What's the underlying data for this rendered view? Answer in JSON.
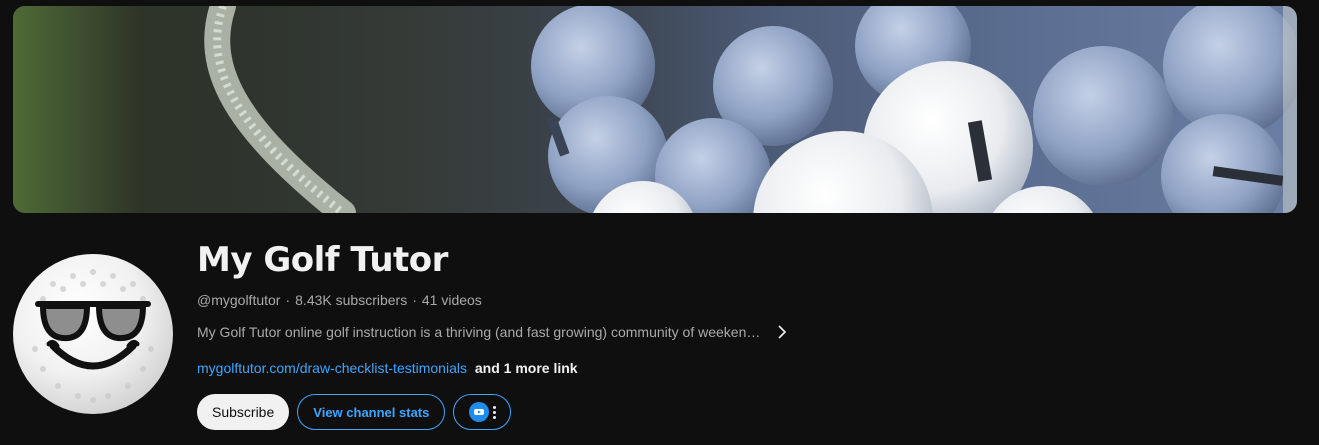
{
  "channel": {
    "name": "My Golf Tutor",
    "handle": "@mygolftutor",
    "subscribers": "8.43K subscribers",
    "videos": "41 videos",
    "separator": "·",
    "description": "My Golf Tutor online golf instruction is a thriving (and fast growing) community of weeken…",
    "link_text": "mygolftutor.com/draw-checklist-testimonials",
    "more_links": "and 1 more link"
  },
  "buttons": {
    "subscribe": "Subscribe",
    "view_stats": "View channel stats"
  },
  "icons": {
    "banner": "golf-balls-banner-image",
    "avatar": "golf-ball-sunglasses-avatar",
    "expand": "chevron-right-icon",
    "extension": "vidiq-extension-icon",
    "more": "more-vertical-icon"
  },
  "colors": {
    "background": "#0f0f0f",
    "link": "#3ea6ff",
    "text_primary": "#f1f1f1",
    "text_secondary": "#aaaaaa"
  }
}
